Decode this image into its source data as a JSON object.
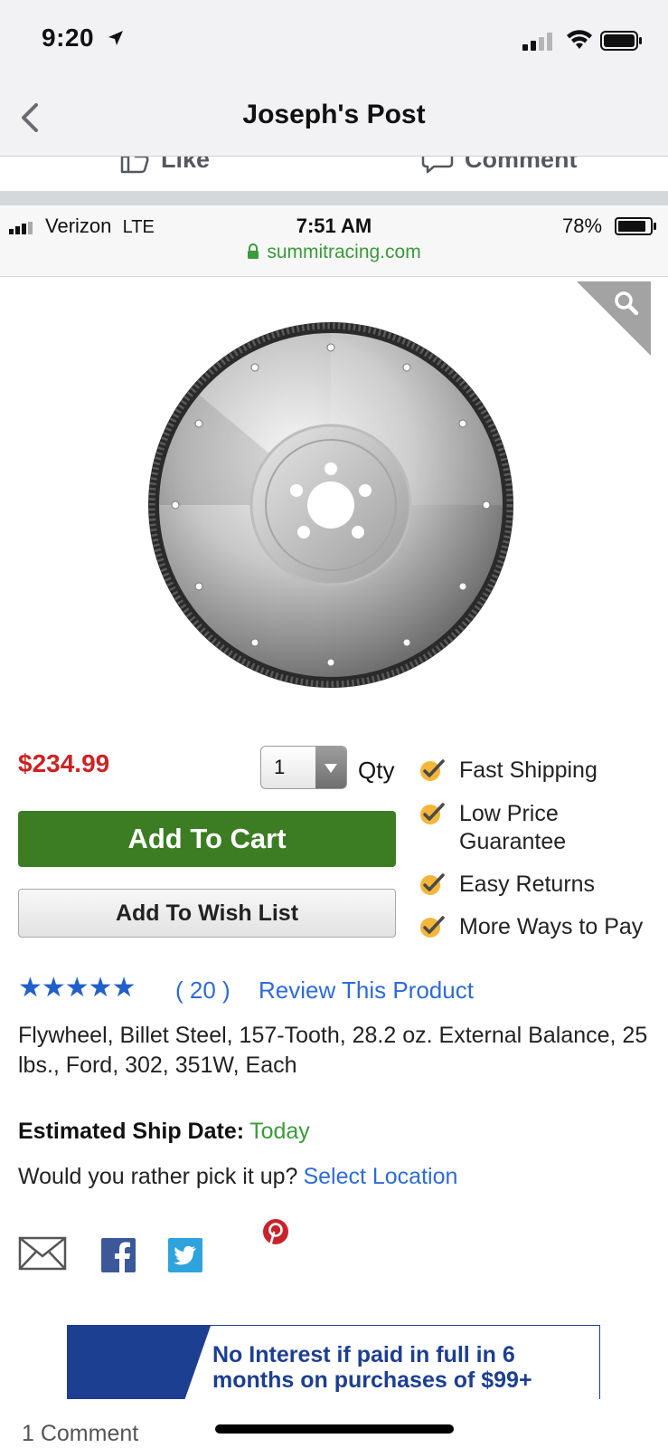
{
  "status_bar": {
    "time": "9:20"
  },
  "nav": {
    "title": "Joseph's Post"
  },
  "post_actions": {
    "like_label": "Like",
    "comment_label": "Comment"
  },
  "embedded": {
    "carrier": "Verizon",
    "network": "LTE",
    "time": "7:51 AM",
    "battery": "78%",
    "url": "summitracing.com"
  },
  "product": {
    "price": "$234.99",
    "qty_value": "1",
    "qty_label": "Qty",
    "add_to_cart": "Add To Cart",
    "add_to_wish_list": "Add To Wish List",
    "features": [
      "Fast Shipping",
      "Low Price Guarantee",
      "Easy Returns",
      "More Ways to Pay"
    ],
    "rating_stars": "★★★★★",
    "rating": 5,
    "review_count": "( 20 )",
    "review_link": "Review This Product",
    "description": "Flywheel, Billet Steel, 157-Tooth, 28.2 oz. External Balance, 25 lbs., Ford, 302, 351W, Each",
    "ship_date_label": "Estimated Ship Date:",
    "ship_date_value": "Today",
    "pickup_text": "Would you rather pick it up?",
    "pickup_link": "Select Location",
    "promo_text": "No Interest if paid in full in 6 months on purchases of $99+"
  },
  "footer": {
    "comment_count": "1 Comment"
  },
  "colors": {
    "price_red": "#cc2222",
    "cart_green": "#3c7d23",
    "link_blue": "#2d6bd6",
    "promo_navy": "#1d3f91",
    "success_green": "#3a9a3a"
  },
  "icons": [
    "location-arrow-icon",
    "signal-icon",
    "wifi-icon",
    "battery-icon",
    "back-chevron-icon",
    "like-icon",
    "comment-icon",
    "lock-icon",
    "zoom-icon",
    "dropdown-arrow-icon",
    "checkmark-icon",
    "email-icon",
    "facebook-icon",
    "twitter-icon",
    "pinterest-icon"
  ]
}
